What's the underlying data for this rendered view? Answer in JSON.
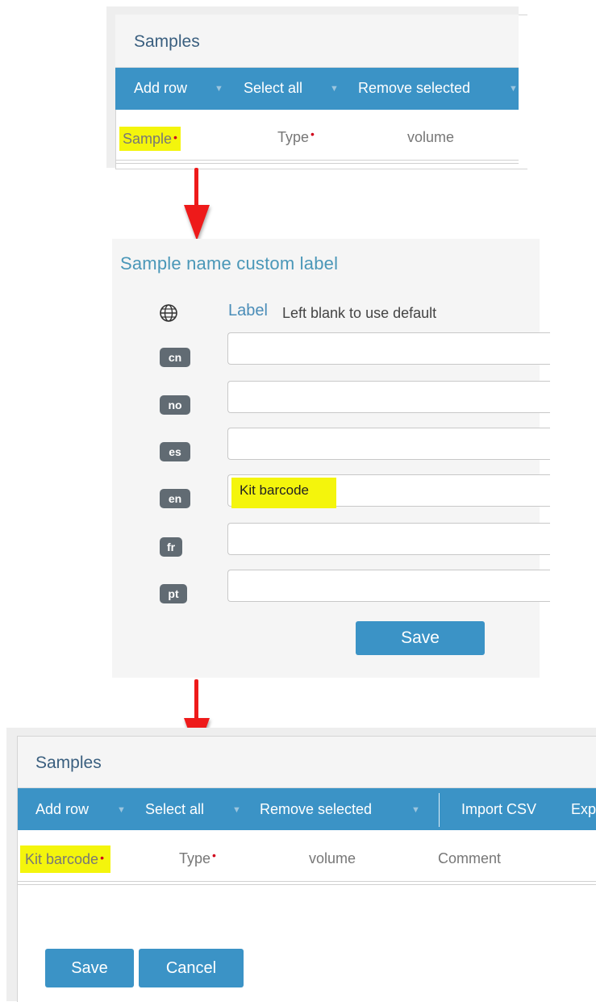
{
  "panel_top": {
    "title": "Samples",
    "toolbar": [
      {
        "label": "Add row"
      },
      {
        "label": "Select all"
      },
      {
        "label": "Remove selected"
      }
    ],
    "columns": {
      "sample": "Sample",
      "type": "Type",
      "volume": "volume"
    },
    "required_marker": "•"
  },
  "custom_label_dialog": {
    "title": "Sample name custom label",
    "label_heading": "Label",
    "label_hint": "Left blank to use default",
    "languages": [
      {
        "code": "cn",
        "value": ""
      },
      {
        "code": "no",
        "value": ""
      },
      {
        "code": "es",
        "value": ""
      },
      {
        "code": "en",
        "value": "Kit barcode"
      },
      {
        "code": "fr",
        "value": ""
      },
      {
        "code": "pt",
        "value": ""
      }
    ],
    "save_label": "Save"
  },
  "panel_bottom": {
    "title": "Samples",
    "toolbar": [
      {
        "label": "Add row"
      },
      {
        "label": "Select all"
      },
      {
        "label": "Remove selected"
      },
      {
        "label": "Import CSV"
      },
      {
        "label": "Exp"
      }
    ],
    "columns": {
      "sample": "Kit barcode",
      "type": "Type",
      "volume": "volume",
      "comment": "Comment"
    },
    "required_marker": "•",
    "save_label": "Save",
    "cancel_label": "Cancel"
  },
  "colors": {
    "toolbar_blue": "#3b93c6",
    "highlight_yellow": "#f4f50c",
    "arrow_red": "#ee1a1a",
    "required_red": "#d0021b"
  }
}
